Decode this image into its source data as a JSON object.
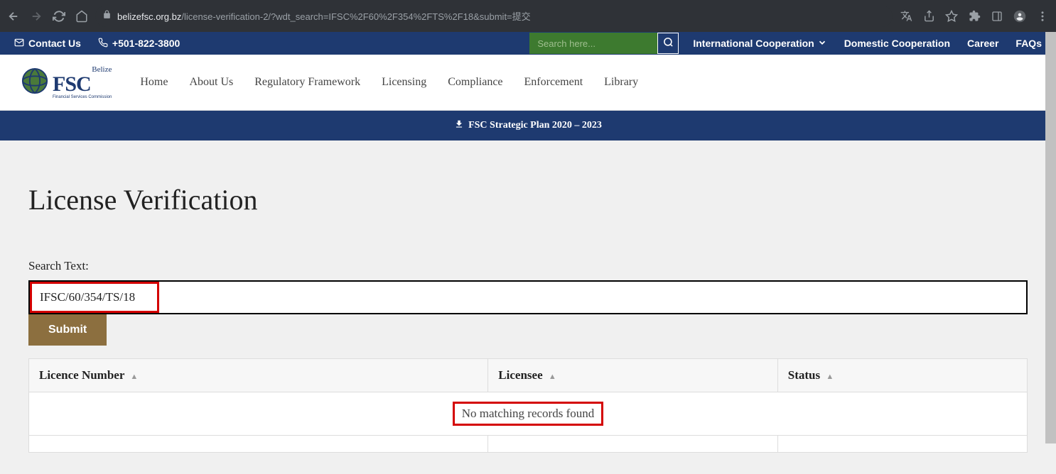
{
  "browser": {
    "url_domain": "belizefsc.org.bz",
    "url_path": "/license-verification-2/?wdt_search=IFSC%2F60%2F354%2FTS%2F18&submit=提交"
  },
  "topbar": {
    "contact_label": "Contact Us",
    "phone": "+501-822-3800",
    "search_placeholder": "Search here...",
    "nav": {
      "intl_coop": "International Cooperation",
      "domestic_coop": "Domestic Cooperation",
      "career": "Career",
      "faqs": "FAQs"
    }
  },
  "logo": {
    "top": "Belize",
    "main": "FSC",
    "sub": "Financial Services Commission"
  },
  "mainnav": {
    "home": "Home",
    "about": "About Us",
    "regulatory": "Regulatory Framework",
    "licensing": "Licensing",
    "compliance": "Compliance",
    "enforcement": "Enforcement",
    "library": "Library"
  },
  "banner": {
    "text": "FSC Strategic Plan 2020 – 2023"
  },
  "page": {
    "title": "License Verification",
    "search_label": "Search Text:",
    "search_value": "IFSC/60/354/TS/18",
    "submit_label": "Submit"
  },
  "table": {
    "columns": {
      "licence_number": "Licence Number",
      "licensee": "Licensee",
      "status": "Status"
    },
    "no_records": "No matching records found"
  }
}
